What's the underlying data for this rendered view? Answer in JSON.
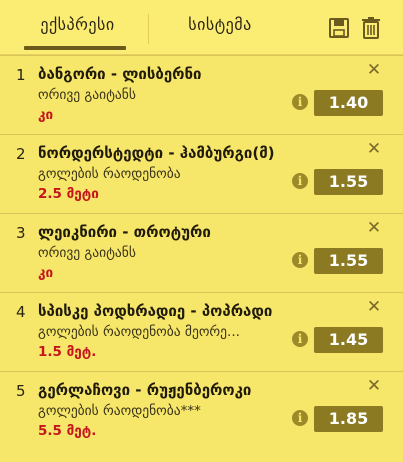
{
  "tabs": {
    "express": "ექსპრესი",
    "system": "სისტემა"
  },
  "icons": {
    "save": "save-icon",
    "trash": "trash-icon",
    "info": "info-icon",
    "close": "close-icon"
  },
  "colors": {
    "background": "#f6e66a",
    "odds_bg": "#8b7a22",
    "pick_text": "#c4161c"
  },
  "bets": [
    {
      "num": "1",
      "title": "ბანგორი - ლისბერნი",
      "market": "ორივე გაიტანს",
      "pick": "კი",
      "odds": "1.40"
    },
    {
      "num": "2",
      "title": "ნორდერსტედტი - ჰამბურგი(მ)",
      "market": "გოლების რაოდენობა",
      "pick": "2.5 მეტი",
      "odds": "1.55"
    },
    {
      "num": "3",
      "title": "ლეიკნირი - თროტური",
      "market": "ორივე გაიტანს",
      "pick": "კი",
      "odds": "1.55"
    },
    {
      "num": "4",
      "title": "სპისკე პოდხრადიე - პოპრადი",
      "market": "გოლების რაოდენობა მეორე...",
      "pick": "1.5 მეტ.",
      "odds": "1.45"
    },
    {
      "num": "5",
      "title": "გერლაჩოვი - რუჟენბეროკი",
      "market": "გოლების რაოდენობა***",
      "pick": "5.5 მეტ.",
      "odds": "1.85"
    }
  ]
}
